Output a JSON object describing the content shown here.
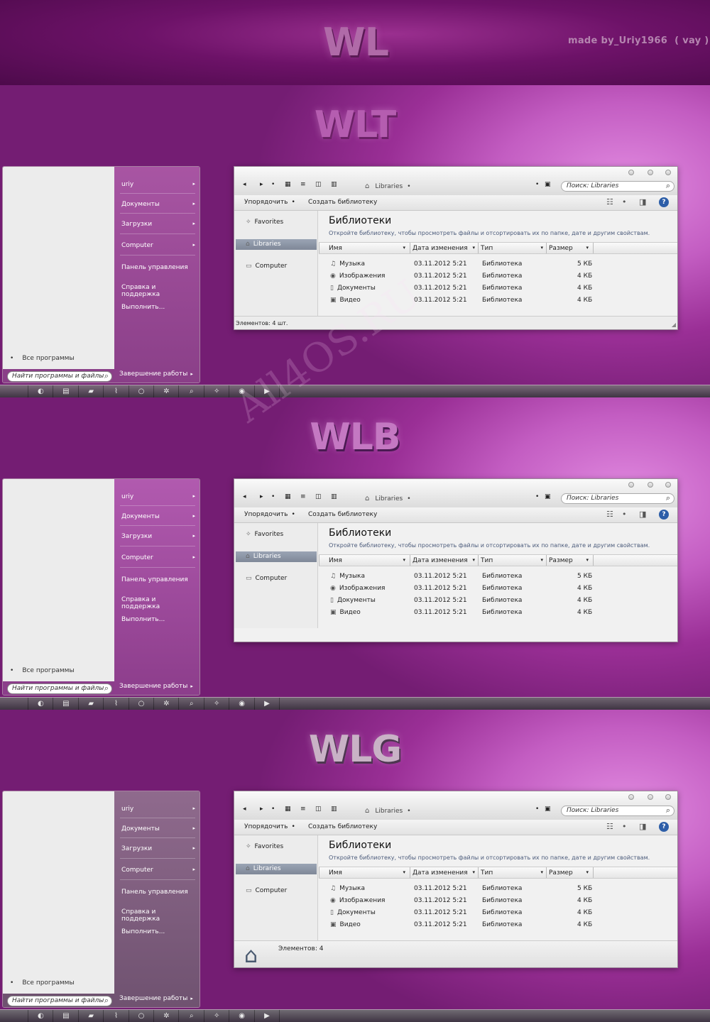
{
  "header": {
    "title": "WL",
    "credit": "made by_Uriy1966",
    "credit_alias": "( vay )"
  },
  "watermark": "All4OS.RU",
  "themes": [
    {
      "label": "WLT",
      "status_mode": "bar",
      "colors": {
        "menu_right_top": "#a855a3",
        "menu_right_bottom": "#8a3f88",
        "taskbar": "#7a6a7a"
      }
    },
    {
      "label": "WLB",
      "status_mode": "none",
      "colors": {
        "menu_right_top": "#b15aaf",
        "menu_right_bottom": "#8c3d8b",
        "taskbar": "#6f6470"
      }
    },
    {
      "label": "WLG",
      "status_mode": "details",
      "colors": {
        "menu_right_top": "#8f6a8d",
        "menu_right_bottom": "#6f5270",
        "taskbar": "#6f6a72"
      }
    }
  ],
  "start_menu": {
    "items": [
      {
        "label": "uriy",
        "arrow": "▸"
      },
      {
        "label": "Документы",
        "arrow": "▸"
      },
      {
        "label": "Загрузки",
        "arrow": "▸"
      },
      {
        "label": "Computer",
        "arrow": "▸"
      },
      {
        "label": "Панель управления",
        "arrow": ""
      },
      {
        "label": "Справка и поддержка",
        "arrow": ""
      },
      {
        "label": "Выполнить...",
        "arrow": ""
      }
    ],
    "all_programs": "Все программы",
    "search_placeholder": "Найти программы и файлы",
    "shutdown": "Завершение работы"
  },
  "explorer": {
    "breadcrumb": "Libraries",
    "search_placeholder": "Поиск: Libraries",
    "toolbar": {
      "organize": "Упорядочить",
      "new_library": "Создать библиотеку"
    },
    "nav": [
      {
        "label": "Favorites",
        "icon": "star-icon"
      },
      {
        "label": "Libraries",
        "icon": "home-icon"
      },
      {
        "label": "Computer",
        "icon": "monitor-icon"
      }
    ],
    "title": "Библиотеки",
    "description": "Откройте библиотеку, чтобы просмотреть файлы и отсортировать их по папке, дате и другим свойствам.",
    "columns": [
      "Имя",
      "Дата изменения",
      "Тип",
      "Размер"
    ],
    "rows": [
      {
        "name": "Музыка",
        "icon": "music-icon",
        "date": "03.11.2012 5:21",
        "type": "Библиотека",
        "size": "5 КБ"
      },
      {
        "name": "Изображения",
        "icon": "camera-icon",
        "date": "03.11.2012 5:21",
        "type": "Библиотека",
        "size": "4 КБ"
      },
      {
        "name": "Документы",
        "icon": "document-icon",
        "date": "03.11.2012 5:21",
        "type": "Библиотека",
        "size": "4 КБ"
      },
      {
        "name": "Видео",
        "icon": "video-icon",
        "date": "03.11.2012 5:21",
        "type": "Библиотека",
        "size": "4 КБ"
      }
    ],
    "status_bar": "Элементов: 4 шт.",
    "details_text": "Элементов: 4"
  },
  "taskbar_icons": [
    "apple-icon",
    "firefox-icon",
    "folder-icon",
    "folder-open-icon",
    "pulse-icon",
    "circle-icon",
    "gear-icon",
    "search-icon",
    "star-icon",
    "camera-icon",
    "play-icon"
  ]
}
